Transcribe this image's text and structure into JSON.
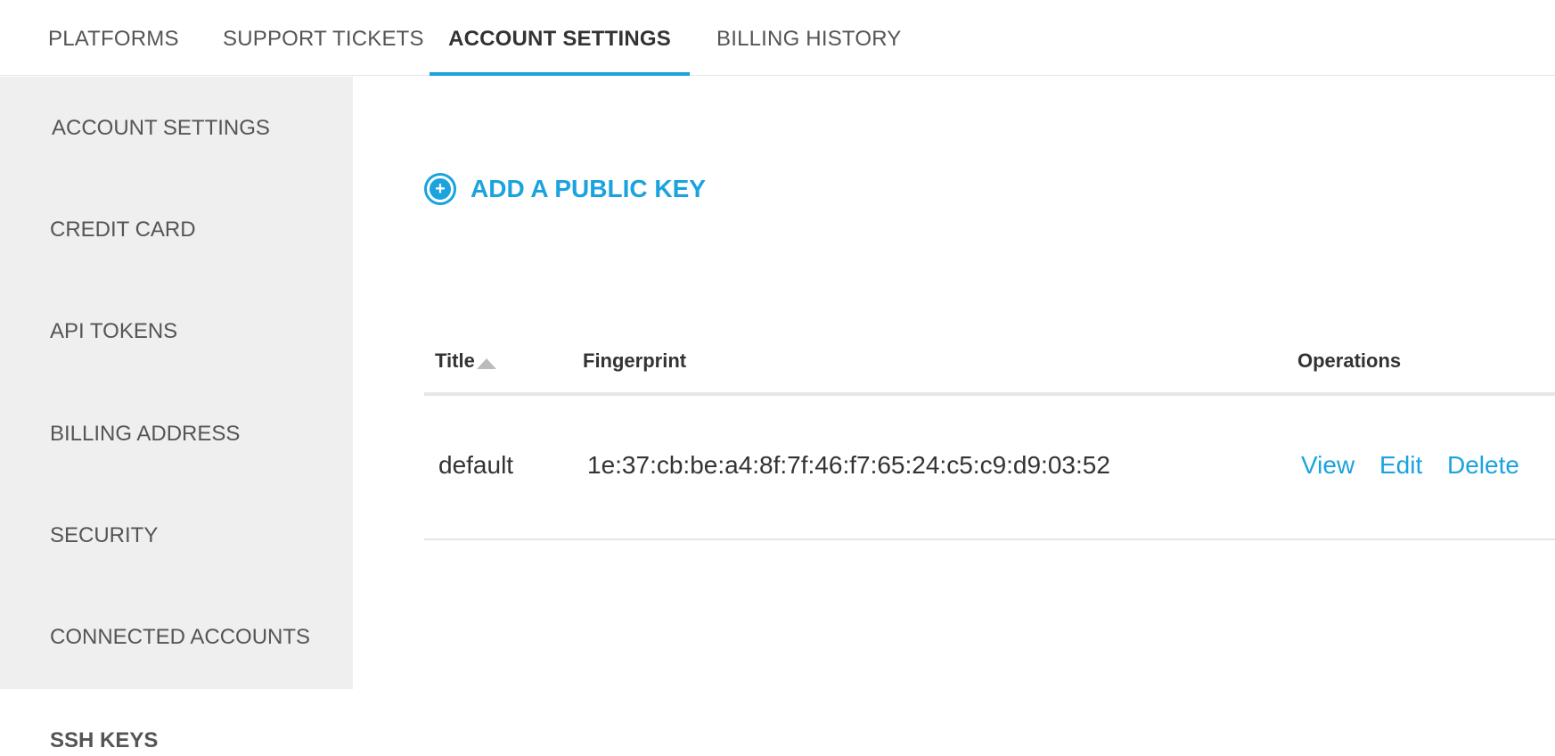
{
  "topnav": {
    "tabs": [
      {
        "label": "PLATFORMS"
      },
      {
        "label": "SUPPORT TICKETS"
      },
      {
        "label": "ACCOUNT SETTINGS"
      },
      {
        "label": "BILLING HISTORY"
      }
    ],
    "active_tab": "ACCOUNT SETTINGS"
  },
  "sidebar": {
    "items": [
      {
        "label": "ACCOUNT SETTINGS"
      },
      {
        "label": "CREDIT CARD"
      },
      {
        "label": "API TOKENS"
      },
      {
        "label": "BILLING ADDRESS"
      },
      {
        "label": "SECURITY"
      },
      {
        "label": "CONNECTED ACCOUNTS"
      },
      {
        "label": "SSH KEYS"
      }
    ],
    "active_item": "SSH KEYS"
  },
  "main": {
    "add_key": {
      "icon": "plus-circle-icon",
      "label": "ADD A PUBLIC KEY"
    },
    "table": {
      "headers": {
        "title": "Title",
        "fingerprint": "Fingerprint",
        "operations": "Operations"
      },
      "sort": {
        "column": "Title",
        "direction": "ascending"
      },
      "rows": [
        {
          "title": "default",
          "fingerprint": "1e:37:cb:be:a4:8f:7f:46:f7:65:24:c5:c9:d9:03:52",
          "operations": [
            "View",
            "Edit",
            "Delete"
          ]
        }
      ]
    }
  },
  "colors": {
    "accent": "#1aa3de",
    "sidebar_bg": "#efefef",
    "text": "#333333",
    "muted_text": "#555555",
    "divider": "#e6e6e6"
  }
}
